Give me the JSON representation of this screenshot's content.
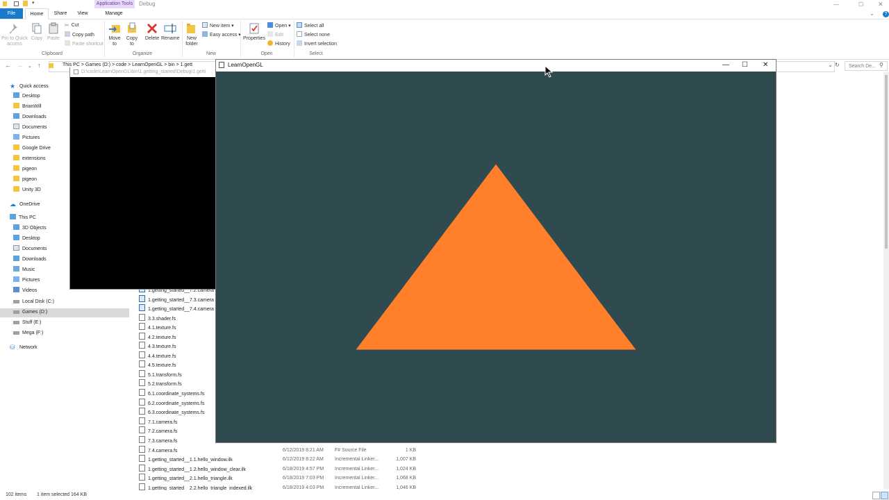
{
  "explorer": {
    "contextual_tab": "Application Tools",
    "title": "Debug",
    "tabs": [
      "File",
      "Home",
      "Share",
      "View",
      "Manage"
    ],
    "ribbon": {
      "clipboard": {
        "pin": "Pin to Quick access",
        "copy": "Copy",
        "paste": "Paste",
        "cut": "Cut",
        "copy_path": "Copy path",
        "paste_shortcut": "Paste shortcut",
        "group": "Clipboard"
      },
      "organize": {
        "move_to": "Move to",
        "copy_to": "Copy to",
        "delete": "Delete",
        "rename": "Rename",
        "group": "Organize"
      },
      "new": {
        "new_folder": "New folder",
        "new_item": "New item",
        "easy_access": "Easy access",
        "group": "New"
      },
      "open": {
        "properties": "Properties",
        "open": "Open",
        "edit": "Edit",
        "history": "History",
        "group": "Open"
      },
      "select": {
        "select_all": "Select all",
        "select_none": "Select none",
        "invert": "Invert selection",
        "group": "Select"
      }
    },
    "address": {
      "crumbs": "This PC  >  Games (D:)  >  code  >  LearnOpenGL  >  bin  >  1.gett",
      "search_placeholder": "Search De..."
    },
    "nav": {
      "quick_access": "Quick access",
      "quick_items": [
        "Desktop",
        "BrianWill",
        "Downloads",
        "Documents",
        "Pictures",
        "Google Drive",
        "extensions",
        "pigeon",
        "pigeon",
        "Unity 3D"
      ],
      "onedrive": "OneDrive",
      "this_pc": "This PC",
      "pc_items": [
        "3D Objects",
        "Desktop",
        "Documents",
        "Downloads",
        "Music",
        "Pictures",
        "Videos",
        "Local Disk (C:)",
        "Games (D:)",
        "Stuff (E:)",
        "Mega (F:)"
      ],
      "network": "Network"
    },
    "files": [
      {
        "name": "1.getting_started__7.2.camera",
        "date": "",
        "type": "",
        "size": "",
        "kind": "exe"
      },
      {
        "name": "1.getting_started__7.3.camera",
        "date": "",
        "type": "",
        "size": "",
        "kind": "exe"
      },
      {
        "name": "1.getting_started__7.4.camera",
        "date": "",
        "type": "",
        "size": "",
        "kind": "exe"
      },
      {
        "name": "3.3.shader.fs",
        "date": "",
        "type": "",
        "size": "",
        "kind": "file"
      },
      {
        "name": "4.1.texture.fs",
        "date": "",
        "type": "",
        "size": "",
        "kind": "file"
      },
      {
        "name": "4.2.texture.fs",
        "date": "",
        "type": "",
        "size": "",
        "kind": "file"
      },
      {
        "name": "4.3.texture.fs",
        "date": "",
        "type": "",
        "size": "",
        "kind": "file"
      },
      {
        "name": "4.4.texture.fs",
        "date": "",
        "type": "",
        "size": "",
        "kind": "file"
      },
      {
        "name": "4.5.texture.fs",
        "date": "",
        "type": "",
        "size": "",
        "kind": "file"
      },
      {
        "name": "5.1.transform.fs",
        "date": "",
        "type": "",
        "size": "",
        "kind": "file"
      },
      {
        "name": "5.2.transform.fs",
        "date": "",
        "type": "",
        "size": "",
        "kind": "file"
      },
      {
        "name": "6.1.coordinate_systems.fs",
        "date": "",
        "type": "",
        "size": "",
        "kind": "file"
      },
      {
        "name": "6.2.coordinate_systems.fs",
        "date": "",
        "type": "",
        "size": "",
        "kind": "file"
      },
      {
        "name": "6.3.coordinate_systems.fs",
        "date": "",
        "type": "",
        "size": "",
        "kind": "file"
      },
      {
        "name": "7.1.camera.fs",
        "date": "",
        "type": "",
        "size": "",
        "kind": "file"
      },
      {
        "name": "7.2.camera.fs",
        "date": "",
        "type": "",
        "size": "",
        "kind": "file"
      },
      {
        "name": "7.3.camera.fs",
        "date": "",
        "type": "",
        "size": "",
        "kind": "file"
      },
      {
        "name": "7.4.camera.fs",
        "date": "6/12/2019 8:21 AM",
        "type": "F# Source File",
        "size": "1 KB",
        "kind": "file"
      },
      {
        "name": "1.getting_started__1.1.hello_window.ilk",
        "date": "6/12/2019 8:22 AM",
        "type": "Incremental Linker...",
        "size": "1,007 KB",
        "kind": "file"
      },
      {
        "name": "1.getting_started__1.2.hello_window_clear.ilk",
        "date": "6/18/2019 4:57 PM",
        "type": "Incremental Linker...",
        "size": "1,024 KB",
        "kind": "file"
      },
      {
        "name": "1.getting_started__2.1.hello_triangle.ilk",
        "date": "6/18/2019 7:03 PM",
        "type": "Incremental Linker...",
        "size": "1,068 KB",
        "kind": "file"
      },
      {
        "name": "1.getting_started__2.2.hello_triangle_indexed.ilk",
        "date": "6/18/2019 4:03 PM",
        "type": "Incremental Linker...",
        "size": "1,046 KB",
        "kind": "file"
      }
    ],
    "status": {
      "items": "102 items",
      "selected": "1 item selected  164 KB"
    }
  },
  "console": {
    "title": "D:\\code\\LearnOpenGL\\bin\\1.getting_started\\Debug\\1.getti"
  },
  "gl_window": {
    "title": "LearnOpenGL",
    "clear_color": "#2f4b4f",
    "triangle_color": "#ff7f2a",
    "triangle_ndc": [
      [
        -0.5,
        -0.5
      ],
      [
        0.5,
        -0.5
      ],
      [
        0.0,
        0.5
      ]
    ]
  }
}
